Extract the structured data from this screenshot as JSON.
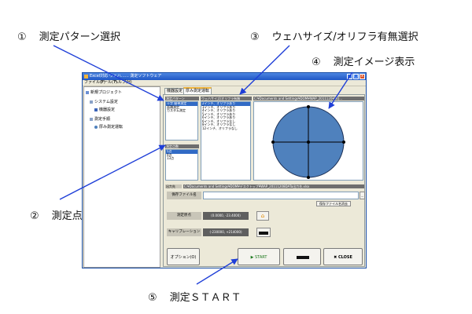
{
  "annotations": [
    {
      "num": "①",
      "text": "測定パターン選択"
    },
    {
      "num": "③",
      "text": "ウェハサイズ/オリフラ有無選択"
    },
    {
      "num": "④",
      "text": "測定イメージ表示"
    },
    {
      "num": "②",
      "text": "測定点数選択"
    },
    {
      "num": "⑤",
      "text": "測定ＳＴＡＲＴ"
    }
  ],
  "window": {
    "title": "Excel対応 ウェハ…… 測定ソフトウェア",
    "minimize_glyph": "_",
    "maximize_glyph": "□",
    "close_glyph": "x"
  },
  "menu": [
    "ファイル(F)",
    "ツール(T)",
    "ヘルプ(H)"
  ],
  "tree": {
    "root": "新規プロジェクト",
    "system_settings": "システム設定",
    "device_settings": "機器設定",
    "measurement_procedure": "測定手順",
    "thickness_run": "厚み測定運転"
  },
  "tabs": [
    "機器設定",
    "厚み測定運転"
  ],
  "pattern": {
    "header": "測定パターン",
    "items": [
      "十字 簡単測定",
      "面積測定",
      "カスタム測定"
    ],
    "selected": 0
  },
  "wafer": {
    "header": "ウェハサイズ/オリフラ有無",
    "items": [
      "2インチ、オリフラあり",
      "3インチ、オリフラあり",
      "4インチ、オリフラあり",
      "5インチ、オリフラあり",
      "6インチ、オリフラあり",
      "6インチ、オリフラなし",
      "8インチ、オリフラなし",
      "12インチ、オリフラなし"
    ],
    "selected": 0
  },
  "points": {
    "header": "測定点数",
    "items": [
      "5点",
      "9点",
      "13点"
    ],
    "selected": 0
  },
  "image_path": "C:¥Documents and Settings¥DOM¥WAP_2011120¥DQ...",
  "output": {
    "label": "出力先",
    "path": "C:¥Documents and Settings¥DOM¥デスクトップ¥WAP_20111208DATa出力先.xlsx"
  },
  "save": {
    "label": "保存ファイル名",
    "value": "",
    "clear_button": "保存ファイル名消去",
    "browse_glyph": "..."
  },
  "measure_point": {
    "label": "測定原点",
    "value": "(0.0000, -23.4000)",
    "button_glyph": "⌂"
  },
  "calibration": {
    "label": "キャリブレーション",
    "value": "(-230000, +214000)"
  },
  "buttons": {
    "option": "オプション(O)",
    "start": "▶ START",
    "close": "✖ CLOSE"
  },
  "colors": {
    "wafer_fill": "#4f81bd",
    "selection": "#316ac5",
    "arrow": "#1f3fd8"
  }
}
